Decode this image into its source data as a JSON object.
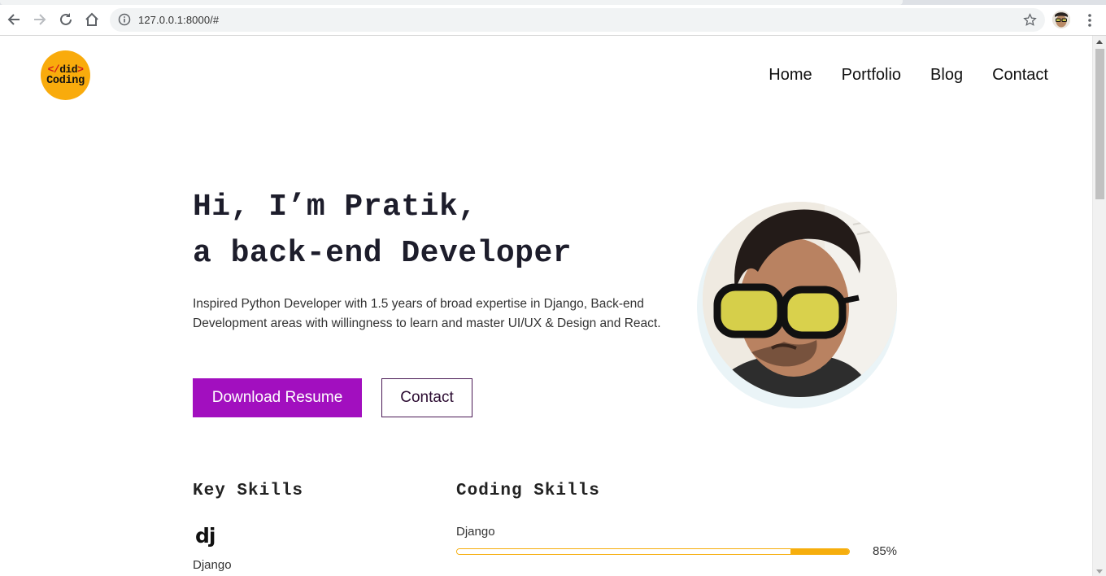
{
  "browser": {
    "url": "127.0.0.1:8000/#"
  },
  "logo": {
    "line1_open": "</",
    "line1_word": "did",
    "line1_close": ">",
    "line2": "Coding"
  },
  "nav": {
    "items": [
      {
        "label": "Home"
      },
      {
        "label": "Portfolio"
      },
      {
        "label": "Blog"
      },
      {
        "label": "Contact"
      }
    ]
  },
  "hero": {
    "title_line1": "Hi, I’m Pratik,",
    "title_line2": "a back-end Developer",
    "description": "Inspired Python Developer with 1.5 years of broad expertise in Django, Back-end Development areas with willingness to learn and master UI/UX & Design and React.",
    "primary_button": "Download Resume",
    "secondary_button": "Contact"
  },
  "key_skills": {
    "title": "Key Skills",
    "items": [
      {
        "icon_text": "dj",
        "icon": "django-icon",
        "label": "Django"
      }
    ]
  },
  "coding_skills": {
    "title": "Coding Skills",
    "items": [
      {
        "label": "Django",
        "percent_text": "85%",
        "percent": 85
      }
    ]
  },
  "colors": {
    "accent_purple": "#a20fbf",
    "accent_yellow": "#f6ae0d",
    "logo_bg": "#f9ab0c"
  }
}
